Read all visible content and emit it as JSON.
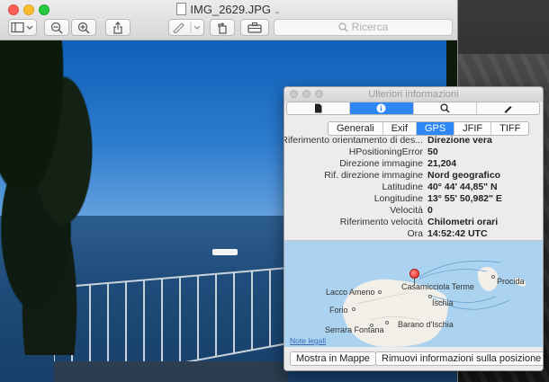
{
  "window": {
    "title": "IMG_2629.JPG",
    "search_placeholder": "Ricerca"
  },
  "toolbar": {
    "icons": [
      "sidebar-icon",
      "zoom-out-icon",
      "zoom-in-icon",
      "share-icon",
      "markup-pen-icon",
      "rotate-icon",
      "toolbox-icon"
    ]
  },
  "inspector": {
    "title": "Ulteriori informazioni",
    "sections": [
      "info-file-icon",
      "info-icon",
      "search-icon",
      "edit-icon"
    ],
    "active_section": 1,
    "tabs": [
      "Generali",
      "Exif",
      "GPS",
      "JFIF",
      "TIFF"
    ],
    "active_tab": "GPS",
    "properties": [
      {
        "label": "Riferimento orientamento di des...",
        "value": "Direzione vera"
      },
      {
        "label": "HPositioningError",
        "value": "50"
      },
      {
        "label": "Direzione immagine",
        "value": "21,204"
      },
      {
        "label": "Rif. direzione immagine",
        "value": "Nord geografico"
      },
      {
        "label": "Latitudine",
        "value": "40° 44' 44,85\" N"
      },
      {
        "label": "Longitudine",
        "value": "13° 55' 50,982\" E"
      },
      {
        "label": "Velocità",
        "value": "0"
      },
      {
        "label": "Riferimento velocità",
        "value": "Chilometri orari"
      },
      {
        "label": "Ora",
        "value": "14:52:42 UTC"
      }
    ],
    "map": {
      "places": [
        "Casamicciola Terme",
        "Lacco Ameno",
        "Ischia",
        "Forio",
        "Barano d'Ischia",
        "Serrara Fontana",
        "Procida"
      ],
      "legal": "Note legali",
      "water_color": "#abd3ef",
      "land_color": "#f2efe8"
    },
    "buttons": {
      "show_in_maps": "Mostra in Mappe",
      "remove_location": "Rimuovi informazioni sulla posizione"
    }
  },
  "colors": {
    "accent": "#2d88f6",
    "close": "#fd5f57",
    "minimize": "#febc2e",
    "zoom": "#28c840",
    "pin": "#e2231a"
  }
}
